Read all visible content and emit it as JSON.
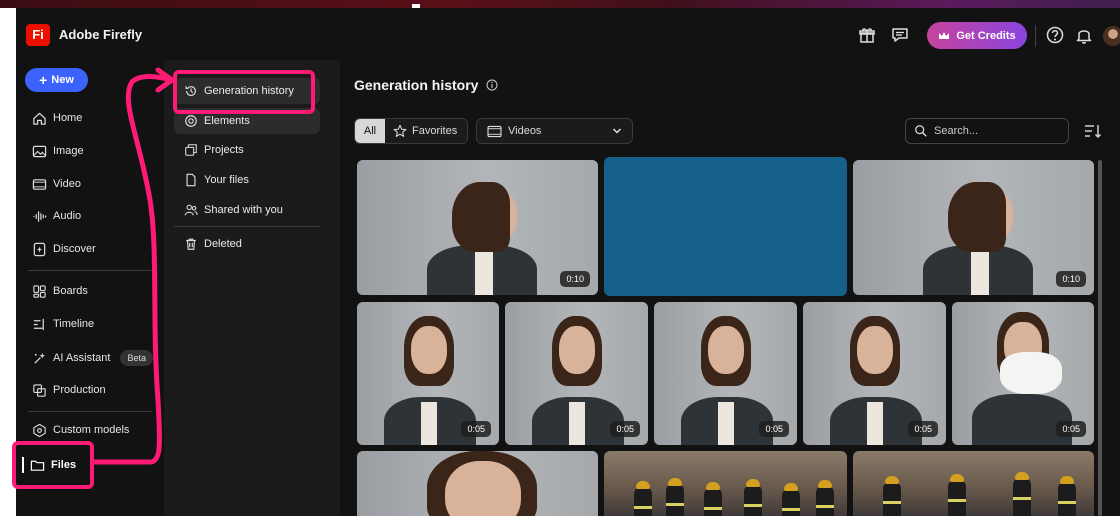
{
  "app": {
    "title": "Adobe Firefly",
    "logo_text": "Fi"
  },
  "header": {
    "credits_label": "Get Credits",
    "icons": [
      "gift-icon",
      "feedback-icon",
      "help-icon",
      "bell-icon"
    ]
  },
  "sidebar": {
    "new_label": "New",
    "items": [
      {
        "label": "Home",
        "icon": "home-icon"
      },
      {
        "label": "Image",
        "icon": "image-icon"
      },
      {
        "label": "Video",
        "icon": "video-icon"
      },
      {
        "label": "Audio",
        "icon": "audio-icon"
      },
      {
        "label": "Discover",
        "icon": "discover-icon"
      },
      {
        "label": "Boards",
        "icon": "boards-icon"
      },
      {
        "label": "Timeline",
        "icon": "timeline-icon"
      },
      {
        "label": "AI Assistant",
        "icon": "ai-assistant-icon",
        "badge": "Beta"
      },
      {
        "label": "Production",
        "icon": "production-icon"
      },
      {
        "label": "Custom models",
        "icon": "custom-models-icon"
      },
      {
        "label": "Files",
        "icon": "folder-icon",
        "selected": true
      }
    ]
  },
  "files_panel": {
    "items": [
      {
        "label": "Generation history",
        "icon": "history-icon",
        "selected": true
      },
      {
        "label": "Elements",
        "icon": "elements-icon"
      },
      {
        "label": "Projects",
        "icon": "projects-icon"
      },
      {
        "label": "Your files",
        "icon": "file-icon"
      },
      {
        "label": "Shared with you",
        "icon": "shared-icon"
      },
      {
        "label": "Deleted",
        "icon": "trash-icon"
      }
    ]
  },
  "main": {
    "title": "Generation history",
    "filter_all": "All",
    "filter_favorites": "Favorites",
    "type_select": "Videos",
    "search_placeholder": "Search..."
  },
  "gallery": {
    "durations": [
      "0:10",
      "0:10",
      "0:05",
      "0:05",
      "0:05",
      "0:05",
      "0:05"
    ],
    "placeholder_color": "#15618a"
  },
  "annotation_color": "#ff1a75"
}
